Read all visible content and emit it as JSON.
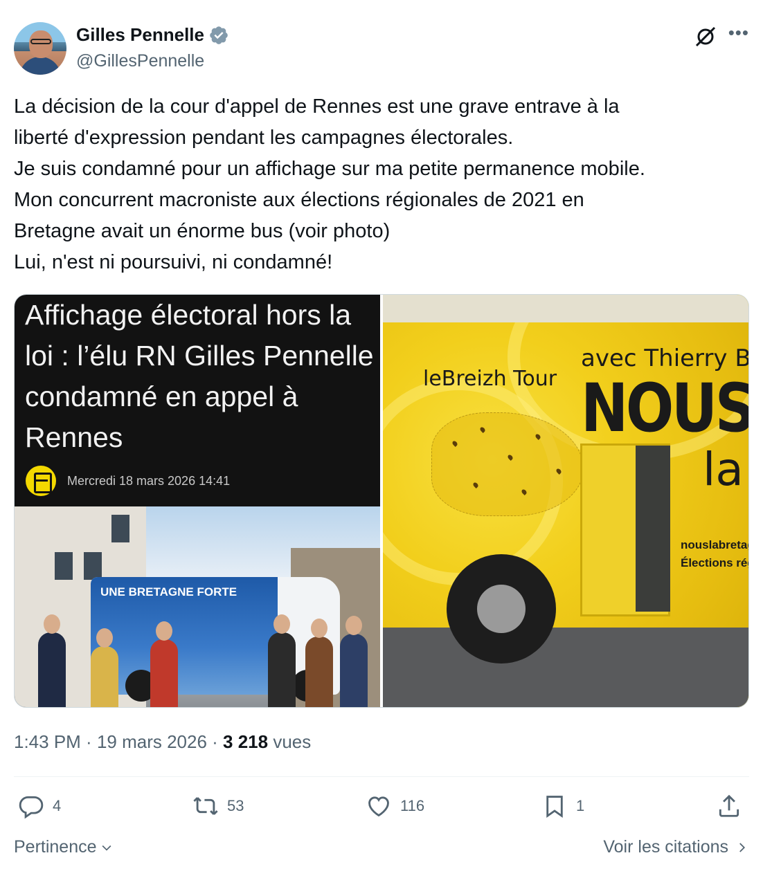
{
  "author": {
    "display_name": "Gilles Pennelle",
    "handle": "@GillesPennelle",
    "verified_color": "#829aab"
  },
  "tweet": {
    "lines": [
      "La décision de la cour d'appel de Rennes est une grave entrave à la",
      "liberté d'expression pendant les campagnes électorales.",
      "Je suis condamné pour un affichage sur ma petite permanence mobile.",
      "Mon concurrent macroniste aux élections régionales de 2021 en",
      "Bretagne avait un énorme bus (voir photo)",
      "Lui, n'est ni poursuivi, ni condamné!"
    ]
  },
  "media": {
    "left": {
      "headline_lines": [
        "Affichage électoral hors la",
        "loi : l’élu RN Gilles Pennelle",
        "condamné en appel à",
        "Rennes"
      ],
      "date": "Mercredi 18 mars 2026 14:41",
      "van_title": "UNE BRETAGNE FORTE"
    },
    "right": {
      "logo_text": "leBreizh Tour",
      "avec": "avec Thierry Bu",
      "nous": "NOUS",
      "la": "la",
      "url": "nouslabretag",
      "elections": "Élections régi"
    }
  },
  "meta": {
    "time": "1:43 PM",
    "sep": " · ",
    "date": "19 mars 2026",
    "views_count": "3 218",
    "views_label": " vues"
  },
  "actions": {
    "replies": "4",
    "reposts": "53",
    "likes": "116",
    "bookmarks": "1"
  },
  "footer": {
    "sort_label": "Pertinence",
    "quotes_label": "Voir les citations"
  },
  "colors": {
    "text": "#0f1419",
    "secondary": "#536471",
    "border": "#cfd9de"
  }
}
